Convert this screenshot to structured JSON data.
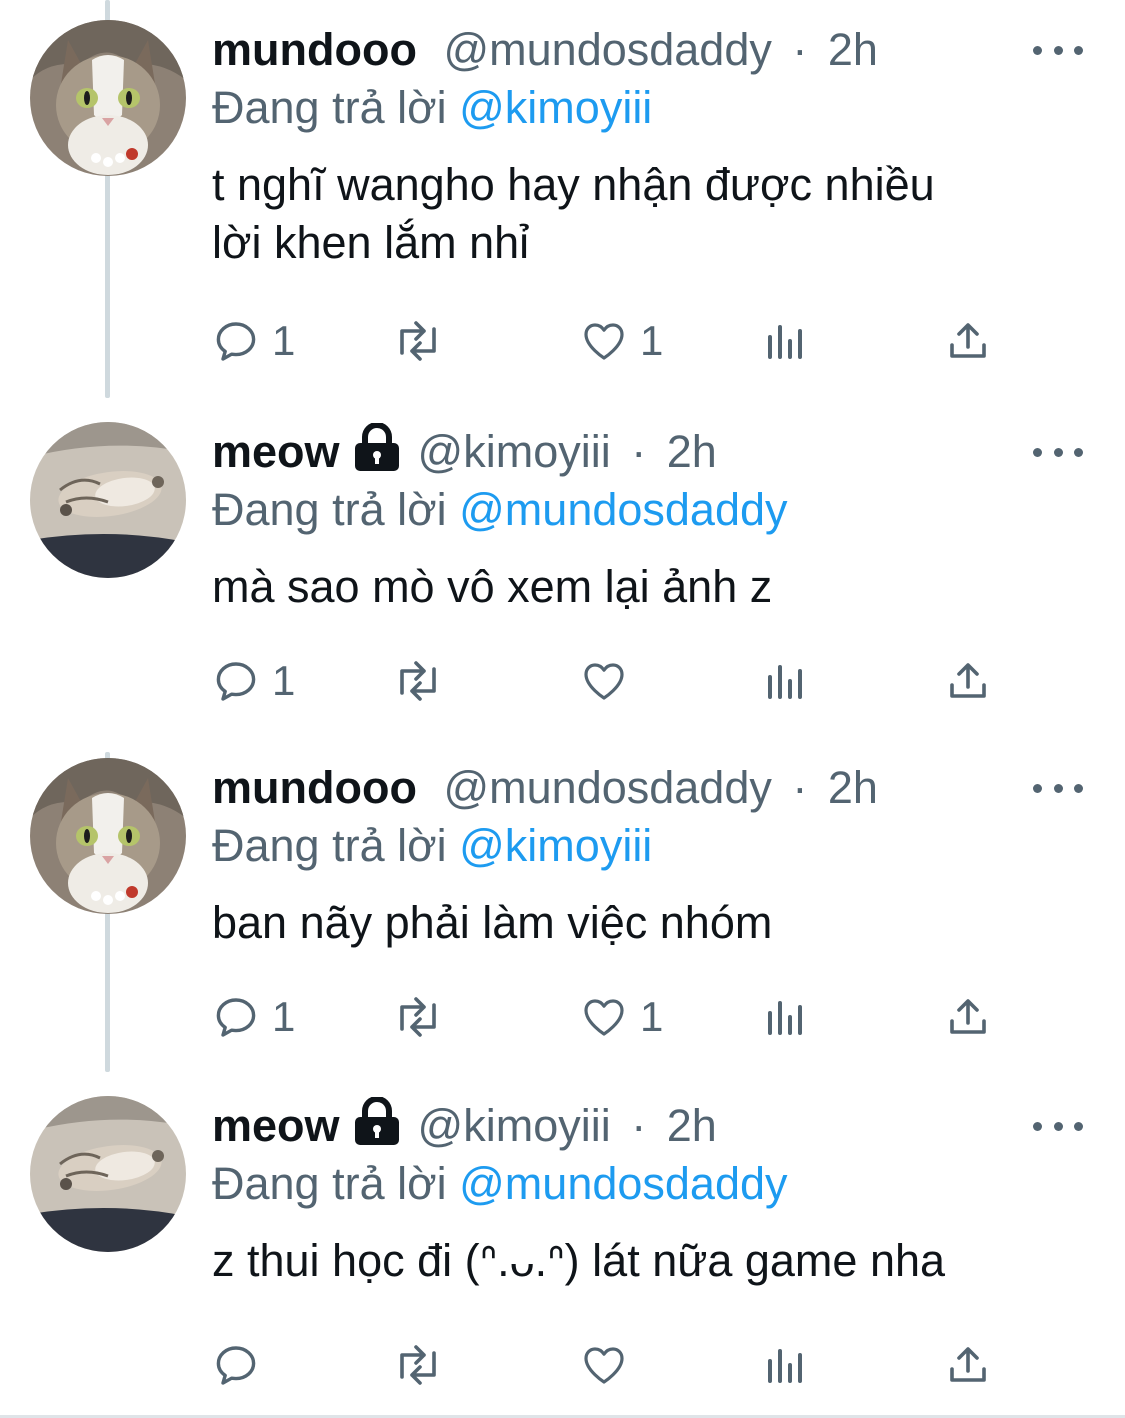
{
  "colors": {
    "accent": "#1d9bf0",
    "secondary_text": "#536471",
    "primary_text": "#0f1419",
    "thread_line": "#cfd9de"
  },
  "tweets": [
    {
      "name": "mundooo",
      "locked": false,
      "handle": "@mundosdaddy",
      "separator": "·",
      "time": "2h",
      "reply_prefix": "Đang trả lời",
      "reply_to": "@kimoyiii",
      "text": "t nghĩ wangho hay nhận được nhiều\nlời khen lắm nhỉ",
      "avatar_icon": "cat-portrait-avatar",
      "reply_count": "1",
      "retweet_count": "",
      "like_count": "1"
    },
    {
      "name": "meow",
      "locked": true,
      "handle": "@kimoyiii",
      "separator": "·",
      "time": "2h",
      "reply_prefix": "Đang trả lời",
      "reply_to": "@mundosdaddy",
      "text": "mà sao mò vô xem lại ảnh z",
      "avatar_icon": "sleeping-kitten-avatar",
      "reply_count": "1",
      "retweet_count": "",
      "like_count": ""
    },
    {
      "name": "mundooo",
      "locked": false,
      "handle": "@mundosdaddy",
      "separator": "·",
      "time": "2h",
      "reply_prefix": "Đang trả lời",
      "reply_to": "@kimoyiii",
      "text": "ban nãy phải làm việc nhóm",
      "avatar_icon": "cat-portrait-avatar",
      "reply_count": "1",
      "retweet_count": "",
      "like_count": "1"
    },
    {
      "name": "meow",
      "locked": true,
      "handle": "@kimoyiii",
      "separator": "·",
      "time": "2h",
      "reply_prefix": "Đang trả lời",
      "reply_to": "@mundosdaddy",
      "text": "z thui học đi (ᐢ.ᴗ.ᐢ) lát nữa game nha",
      "avatar_icon": "sleeping-kitten-avatar",
      "reply_count": "",
      "retweet_count": "",
      "like_count": ""
    }
  ]
}
